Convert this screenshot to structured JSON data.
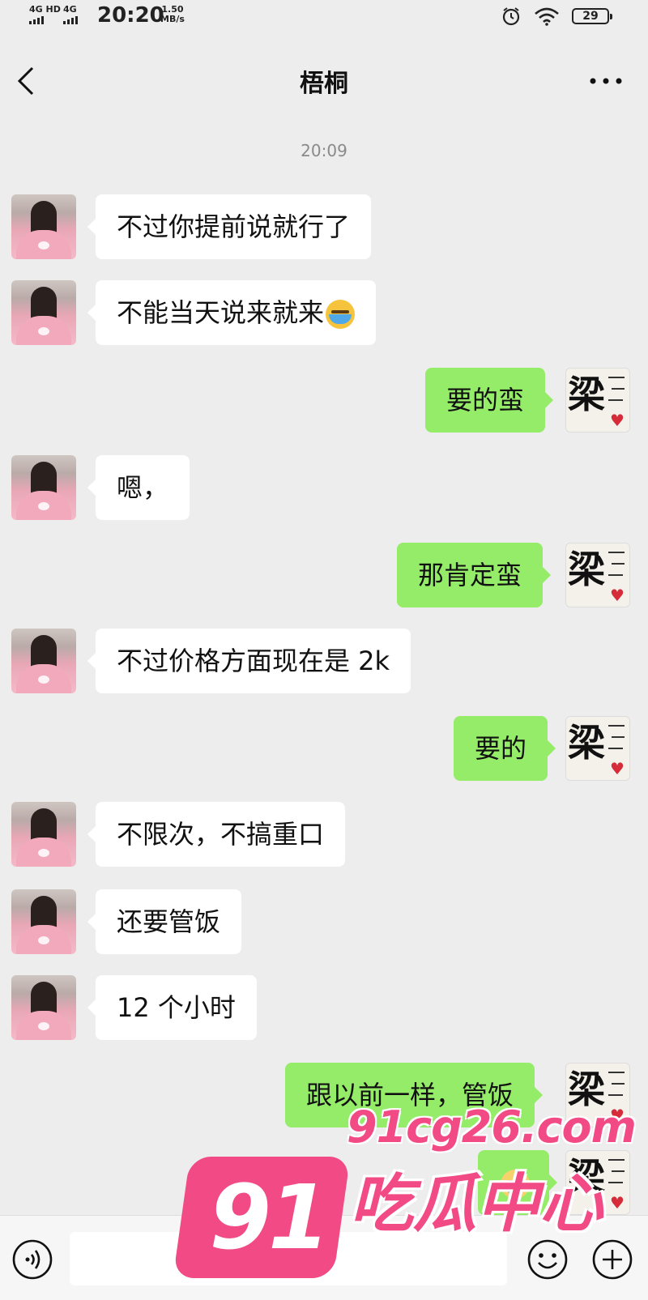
{
  "status_bar": {
    "net1": "4G HD",
    "net2": "4G",
    "time": "20:20",
    "speed_value": "1.50",
    "speed_unit": "MB/s",
    "battery": "29"
  },
  "header": {
    "title": "梧桐"
  },
  "chat": {
    "timestamp": "20:09",
    "messages": [
      {
        "side": "left",
        "text": "不过你提前说就行了"
      },
      {
        "side": "left",
        "text": "不能当天说来就来",
        "emoji": "crying-laughing-emoji"
      },
      {
        "side": "right",
        "text": "要的蛮"
      },
      {
        "side": "left",
        "text": "嗯，"
      },
      {
        "side": "right",
        "text": "那肯定蛮"
      },
      {
        "side": "left",
        "text": "不过价格方面现在是 2k"
      },
      {
        "side": "right",
        "text": "要的"
      },
      {
        "side": "left",
        "text": "不限次，不搞重口"
      },
      {
        "side": "left",
        "text": "还要管饭"
      },
      {
        "side": "left",
        "text": "12 个小时"
      },
      {
        "side": "right",
        "text": "跟以前一样，管饭"
      }
    ],
    "my_avatar_char": "梁"
  },
  "watermark": {
    "number": "91",
    "url": "91cg26.com",
    "text": "吃瓜中心"
  },
  "colors": {
    "background": "#ededed",
    "sent_bubble": "#95ec69",
    "received_bubble": "#ffffff",
    "watermark": "#f24a84"
  }
}
